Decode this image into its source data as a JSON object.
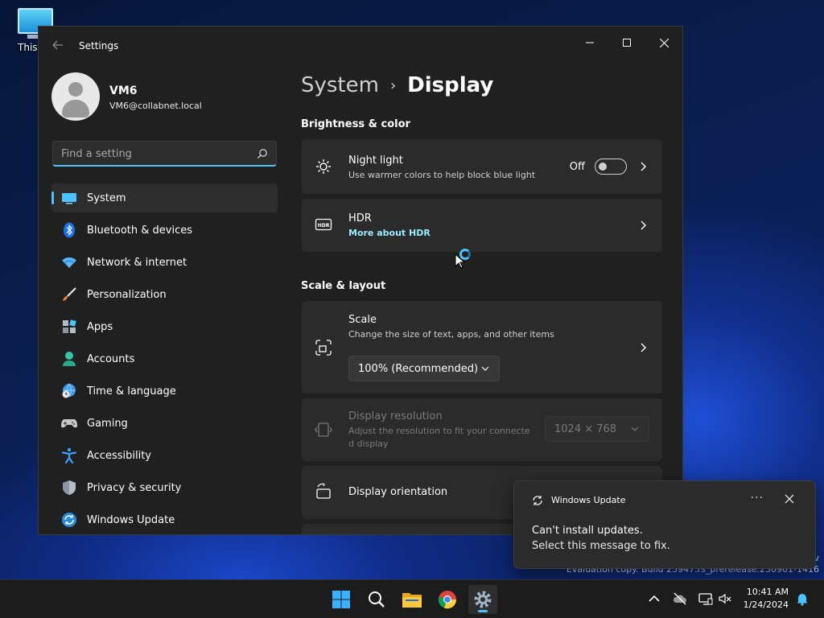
{
  "desktop": {
    "icon_label": "This PC"
  },
  "window": {
    "title": "Settings",
    "minimize": "–",
    "close": "✕"
  },
  "profile": {
    "name": "VM6",
    "email": "VM6@collabnet.local"
  },
  "search": {
    "placeholder": "Find a setting"
  },
  "sidebar": {
    "items": [
      {
        "label": "System",
        "icon": "monitor-icon"
      },
      {
        "label": "Bluetooth & devices",
        "icon": "bluetooth-icon"
      },
      {
        "label": "Network & internet",
        "icon": "wifi-icon"
      },
      {
        "label": "Personalization",
        "icon": "brush-icon"
      },
      {
        "label": "Apps",
        "icon": "apps-icon"
      },
      {
        "label": "Accounts",
        "icon": "person-icon"
      },
      {
        "label": "Time & language",
        "icon": "globe-clock-icon"
      },
      {
        "label": "Gaming",
        "icon": "gamepad-icon"
      },
      {
        "label": "Accessibility",
        "icon": "accessibility-icon"
      },
      {
        "label": "Privacy & security",
        "icon": "shield-icon"
      },
      {
        "label": "Windows Update",
        "icon": "update-icon"
      }
    ]
  },
  "main": {
    "breadcrumb": {
      "parent": "System",
      "separator": "›",
      "current": "Display"
    },
    "brightness_section": "Brightness & color",
    "night_light": {
      "title": "Night light",
      "subtitle": "Use warmer colors to help block blue light",
      "state_label": "Off"
    },
    "hdr": {
      "title": "HDR",
      "link": "More about HDR"
    },
    "scale_section": "Scale & layout",
    "scale": {
      "title": "Scale",
      "subtitle": "Change the size of text, apps, and other items",
      "value": "100% (Recommended)"
    },
    "resolution": {
      "title": "Display resolution",
      "subtitle_l1": "Adjust the resolution to fit your connecte",
      "subtitle_l2": "d display",
      "value": "1024 × 768"
    },
    "orientation": {
      "title": "Display orientation"
    }
  },
  "watermark": {
    "line1": "v",
    "line2": "Evaluation copy. Build 25947.rs_prerelease.230901-1416"
  },
  "toast": {
    "app": "Windows Update",
    "more": "···",
    "line1": "Can't install updates.",
    "line2": "Select this message to fix."
  },
  "taskbar": {
    "time": "10:41 AM",
    "date": "1/24/2024"
  },
  "colors": {
    "accent": "#4cc2ff",
    "window_bg": "#202020",
    "card_bg": "#2b2b2b"
  }
}
